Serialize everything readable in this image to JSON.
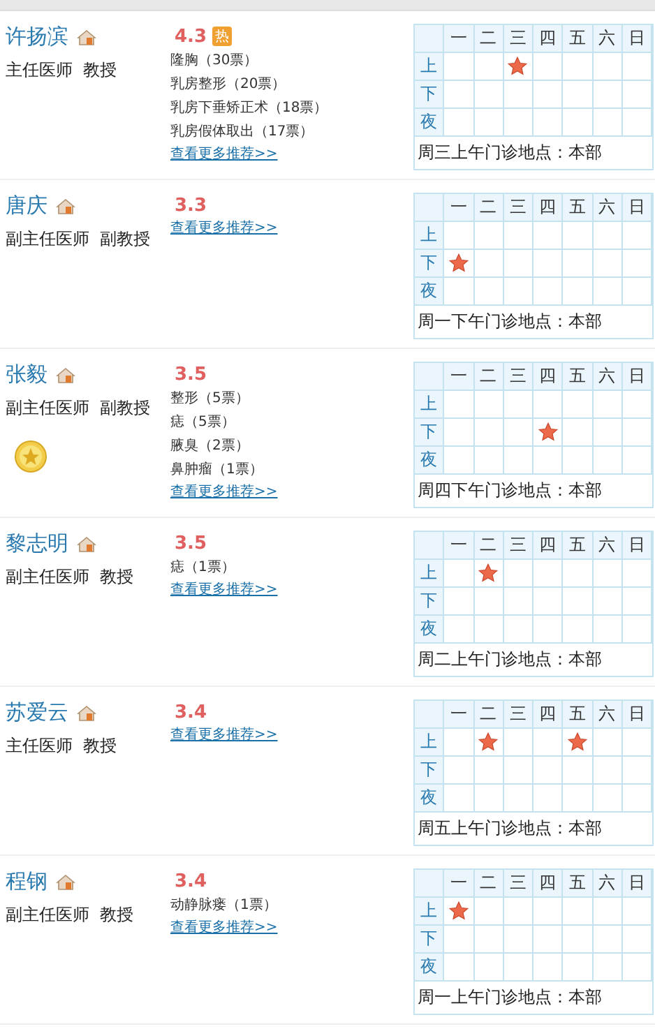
{
  "doctors": [
    {
      "name": "许扬滨",
      "title": "主任医师  教授",
      "medal": false,
      "score": "4.3",
      "hot_label": "热",
      "votes": [
        "隆胸（30票）",
        "乳房整形（20票）",
        "乳房下垂矫正术（18票）",
        "乳房假体取出（17票）"
      ],
      "more_link": "查看更多推荐>>",
      "schedule": {
        "days": [
          "一",
          "二",
          "三",
          "四",
          "五",
          "六",
          "日"
        ],
        "rows": [
          {
            "label": "上",
            "slots": [
              false,
              false,
              true,
              false,
              false,
              false,
              false
            ]
          },
          {
            "label": "下",
            "slots": [
              false,
              false,
              false,
              false,
              false,
              false,
              false
            ]
          },
          {
            "label": "夜",
            "slots": [
              false,
              false,
              false,
              false,
              false,
              false,
              false
            ]
          }
        ],
        "note": "周三上午门诊地点：本部"
      }
    },
    {
      "name": "唐庆",
      "title": "副主任医师  副教授",
      "medal": false,
      "score": "3.3",
      "more_link": "查看更多推荐>>",
      "schedule": {
        "days": [
          "一",
          "二",
          "三",
          "四",
          "五",
          "六",
          "日"
        ],
        "rows": [
          {
            "label": "上",
            "slots": [
              false,
              false,
              false,
              false,
              false,
              false,
              false
            ]
          },
          {
            "label": "下",
            "slots": [
              true,
              false,
              false,
              false,
              false,
              false,
              false
            ]
          },
          {
            "label": "夜",
            "slots": [
              false,
              false,
              false,
              false,
              false,
              false,
              false
            ]
          }
        ],
        "note": "周一下午门诊地点：本部"
      }
    },
    {
      "name": "张毅",
      "title": "副主任医师  副教授",
      "medal": true,
      "score": "3.5",
      "votes": [
        "整形（5票）",
        "痣（5票）",
        "腋臭（2票）",
        "鼻肿瘤（1票）"
      ],
      "more_link": "查看更多推荐>>",
      "schedule": {
        "days": [
          "一",
          "二",
          "三",
          "四",
          "五",
          "六",
          "日"
        ],
        "rows": [
          {
            "label": "上",
            "slots": [
              false,
              false,
              false,
              false,
              false,
              false,
              false
            ]
          },
          {
            "label": "下",
            "slots": [
              false,
              false,
              false,
              true,
              false,
              false,
              false
            ]
          },
          {
            "label": "夜",
            "slots": [
              false,
              false,
              false,
              false,
              false,
              false,
              false
            ]
          }
        ],
        "note": "周四下午门诊地点：本部"
      }
    },
    {
      "name": "黎志明",
      "title": "副主任医师  教授",
      "medal": false,
      "score": "3.5",
      "votes": [
        "痣（1票）"
      ],
      "more_link": "查看更多推荐>>",
      "schedule": {
        "days": [
          "一",
          "二",
          "三",
          "四",
          "五",
          "六",
          "日"
        ],
        "rows": [
          {
            "label": "上",
            "slots": [
              false,
              true,
              false,
              false,
              false,
              false,
              false
            ]
          },
          {
            "label": "下",
            "slots": [
              false,
              false,
              false,
              false,
              false,
              false,
              false
            ]
          },
          {
            "label": "夜",
            "slots": [
              false,
              false,
              false,
              false,
              false,
              false,
              false
            ]
          }
        ],
        "note": "周二上午门诊地点：本部"
      }
    },
    {
      "name": "苏爱云",
      "title": "主任医师  教授",
      "medal": false,
      "score": "3.4",
      "more_link": "查看更多推荐>>",
      "schedule": {
        "days": [
          "一",
          "二",
          "三",
          "四",
          "五",
          "六",
          "日"
        ],
        "rows": [
          {
            "label": "上",
            "slots": [
              false,
              true,
              false,
              false,
              true,
              false,
              false
            ]
          },
          {
            "label": "下",
            "slots": [
              false,
              false,
              false,
              false,
              false,
              false,
              false
            ]
          },
          {
            "label": "夜",
            "slots": [
              false,
              false,
              false,
              false,
              false,
              false,
              false
            ]
          }
        ],
        "note": "周五上午门诊地点：本部"
      }
    },
    {
      "name": "程钢",
      "title": "副主任医师  教授",
      "medal": false,
      "score": "3.4",
      "votes": [
        "动静脉瘘（1票）"
      ],
      "more_link": "查看更多推荐>>",
      "schedule": {
        "days": [
          "一",
          "二",
          "三",
          "四",
          "五",
          "六",
          "日"
        ],
        "rows": [
          {
            "label": "上",
            "slots": [
              true,
              false,
              false,
              false,
              false,
              false,
              false
            ]
          },
          {
            "label": "下",
            "slots": [
              false,
              false,
              false,
              false,
              false,
              false,
              false
            ]
          },
          {
            "label": "夜",
            "slots": [
              false,
              false,
              false,
              false,
              false,
              false,
              false
            ]
          }
        ],
        "note": "周一上午门诊地点：本部"
      }
    }
  ]
}
